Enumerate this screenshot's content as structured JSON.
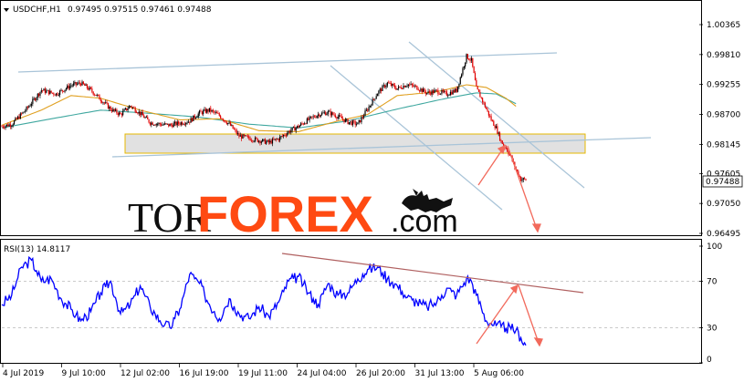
{
  "header": {
    "symbol": "USDCHF,H1",
    "ohlc": "0.97495 0.97515 0.97461 0.97488",
    "rsi_label": "RSI(13) 14.8117"
  },
  "watermark": {
    "part1": "TOR",
    "part2": "FOREX",
    "part3": ".com",
    "bull_bear_logo": "bull-bear-icon"
  },
  "colors": {
    "candle_up": "#000000",
    "candle_down": "#e00000",
    "ma_fast": "#e0a020",
    "ma_slow": "#40a8a0",
    "channel_line": "#a9c4d8",
    "zone_fill": "#c8c8c8",
    "zone_border": "#e6b800",
    "arrow": "#f26a5c",
    "rsi_line": "#0000ff",
    "rsi_trend": "#b06060",
    "price_label_bg": "#ffffff"
  },
  "chart_data": [
    {
      "type": "candlestick",
      "series_label": "USDCHF,H1",
      "y_ticks": [
        "1.00365",
        "0.99810",
        "0.99255",
        "0.98700",
        "0.98145",
        "0.97605",
        "0.97050",
        "0.96495"
      ],
      "ylim": [
        0.96495,
        1.00365
      ],
      "current_price": "0.97488",
      "price_path": [
        [
          0,
          0.9848
        ],
        [
          2,
          0.9852
        ],
        [
          5,
          0.988
        ],
        [
          8,
          0.9915
        ],
        [
          11,
          0.9908
        ],
        [
          14,
          0.9924
        ],
        [
          16,
          0.9928
        ],
        [
          18,
          0.9915
        ],
        [
          20,
          0.9898
        ],
        [
          22,
          0.988
        ],
        [
          24,
          0.987
        ],
        [
          26,
          0.9886
        ],
        [
          28,
          0.9872
        ],
        [
          30,
          0.9855
        ],
        [
          32,
          0.9852
        ],
        [
          34,
          0.985
        ],
        [
          36,
          0.9854
        ],
        [
          38,
          0.9858
        ],
        [
          40,
          0.9873
        ],
        [
          42,
          0.9878
        ],
        [
          44,
          0.9868
        ],
        [
          46,
          0.9852
        ],
        [
          48,
          0.983
        ],
        [
          50,
          0.9826
        ],
        [
          52,
          0.9822
        ],
        [
          54,
          0.9818
        ],
        [
          56,
          0.9825
        ],
        [
          58,
          0.9838
        ],
        [
          60,
          0.9848
        ],
        [
          62,
          0.986
        ],
        [
          64,
          0.987
        ],
        [
          66,
          0.9874
        ],
        [
          68,
          0.9866
        ],
        [
          70,
          0.9856
        ],
        [
          72,
          0.9852
        ],
        [
          74,
          0.988
        ],
        [
          76,
          0.991
        ],
        [
          78,
          0.9928
        ],
        [
          80,
          0.9918
        ],
        [
          82,
          0.9926
        ],
        [
          84,
          0.992
        ],
        [
          86,
          0.991
        ],
        [
          88,
          0.9913
        ],
        [
          90,
          0.9908
        ],
        [
          92,
          0.9915
        ],
        [
          94,
          0.9978
        ],
        [
          95,
          0.997
        ],
        [
          96,
          0.9918
        ],
        [
          97,
          0.99
        ],
        [
          98,
          0.988
        ],
        [
          99,
          0.986
        ],
        [
          100,
          0.9845
        ],
        [
          101,
          0.982
        ],
        [
          102,
          0.9808
        ],
        [
          103,
          0.979
        ],
        [
          104,
          0.9768
        ],
        [
          105,
          0.975
        ],
        [
          106,
          0.9749
        ]
      ],
      "fast_ma_path": [
        [
          0,
          0.985
        ],
        [
          8,
          0.9878
        ],
        [
          14,
          0.9905
        ],
        [
          20,
          0.99
        ],
        [
          28,
          0.9878
        ],
        [
          36,
          0.986
        ],
        [
          44,
          0.9862
        ],
        [
          52,
          0.984
        ],
        [
          60,
          0.9838
        ],
        [
          68,
          0.9858
        ],
        [
          74,
          0.987
        ],
        [
          80,
          0.9905
        ],
        [
          88,
          0.9912
        ],
        [
          94,
          0.9925
        ],
        [
          98,
          0.992
        ],
        [
          102,
          0.99
        ],
        [
          104,
          0.9885
        ]
      ],
      "slow_ma_path": [
        [
          0,
          0.9845
        ],
        [
          10,
          0.9862
        ],
        [
          20,
          0.9878
        ],
        [
          30,
          0.9872
        ],
        [
          40,
          0.9865
        ],
        [
          50,
          0.9852
        ],
        [
          60,
          0.9845
        ],
        [
          70,
          0.9858
        ],
        [
          80,
          0.988
        ],
        [
          90,
          0.99
        ],
        [
          96,
          0.991
        ],
        [
          100,
          0.9908
        ],
        [
          104,
          0.989
        ]
      ]
    },
    {
      "type": "line",
      "series_label": "RSI(13)",
      "current_value": 14.8117,
      "y_ticks": [
        "100",
        "70",
        "30",
        "0"
      ],
      "ylim": [
        0,
        100
      ],
      "x_tick_labels": [
        "4 Jul 2019",
        "9 Jul 10:00",
        "12 Jul 02:00",
        "16 Jul 19:00",
        "19 Jul 11:00",
        "24 Jul 04:00",
        "26 Jul 20:00",
        "31 Jul 13:00",
        "5 Aug 06:00"
      ],
      "rsi_path": [
        [
          0,
          50
        ],
        [
          2,
          58
        ],
        [
          4,
          82
        ],
        [
          6,
          88
        ],
        [
          8,
          70
        ],
        [
          10,
          72
        ],
        [
          12,
          55
        ],
        [
          14,
          46
        ],
        [
          16,
          36
        ],
        [
          18,
          44
        ],
        [
          20,
          60
        ],
        [
          22,
          70
        ],
        [
          24,
          42
        ],
        [
          26,
          50
        ],
        [
          28,
          66
        ],
        [
          30,
          48
        ],
        [
          32,
          36
        ],
        [
          34,
          30
        ],
        [
          36,
          46
        ],
        [
          38,
          76
        ],
        [
          40,
          68
        ],
        [
          42,
          50
        ],
        [
          44,
          38
        ],
        [
          46,
          55
        ],
        [
          48,
          42
        ],
        [
          50,
          38
        ],
        [
          52,
          48
        ],
        [
          54,
          40
        ],
        [
          56,
          52
        ],
        [
          58,
          70
        ],
        [
          60,
          74
        ],
        [
          62,
          60
        ],
        [
          64,
          50
        ],
        [
          66,
          68
        ],
        [
          68,
          58
        ],
        [
          70,
          60
        ],
        [
          72,
          72
        ],
        [
          74,
          80
        ],
        [
          76,
          82
        ],
        [
          78,
          72
        ],
        [
          80,
          66
        ],
        [
          82,
          56
        ],
        [
          84,
          52
        ],
        [
          86,
          48
        ],
        [
          88,
          52
        ],
        [
          90,
          64
        ],
        [
          92,
          58
        ],
        [
          94,
          72
        ],
        [
          95,
          70
        ],
        [
          96,
          58
        ],
        [
          98,
          36
        ],
        [
          100,
          32
        ],
        [
          102,
          30
        ],
        [
          104,
          28
        ],
        [
          106,
          15
        ]
      ]
    }
  ]
}
